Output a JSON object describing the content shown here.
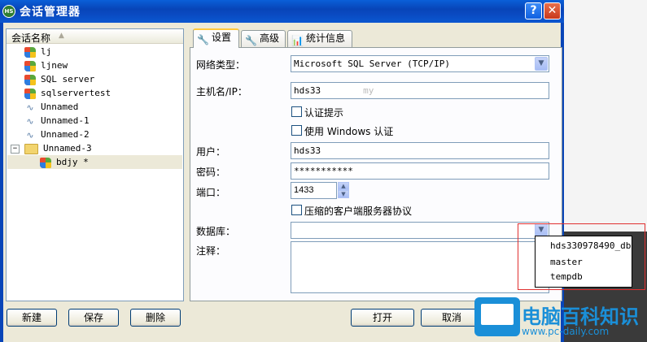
{
  "window": {
    "title": "会话管理器",
    "app_icon": "HS",
    "help_glyph": "?",
    "close_glyph": "✕"
  },
  "tree": {
    "header": "会话名称",
    "items": [
      {
        "label": "lj",
        "icon": "windows-icon"
      },
      {
        "label": "ljnew",
        "icon": "windows-icon"
      },
      {
        "label": "SQL server",
        "icon": "windows-icon"
      },
      {
        "label": "sqlservertest",
        "icon": "windows-icon"
      },
      {
        "label": "Unnamed",
        "icon": "mysql-dolphin-icon"
      },
      {
        "label": "Unnamed-1",
        "icon": "mysql-dolphin-icon"
      },
      {
        "label": "Unnamed-2",
        "icon": "mysql-dolphin-icon"
      },
      {
        "label": "Unnamed-3",
        "icon": "folder-icon",
        "expander": "−"
      },
      {
        "label": "bdjy *",
        "icon": "windows-edit-icon"
      }
    ]
  },
  "buttons": {
    "new": "新建",
    "save": "保存",
    "delete": "删除",
    "open": "打开",
    "cancel": "取消"
  },
  "tabs": [
    {
      "label": "设置",
      "icon": "wrench-icon"
    },
    {
      "label": "高级",
      "icon": "wrench-icon"
    },
    {
      "label": "统计信息",
      "icon": "bar-chart-icon"
    }
  ],
  "form": {
    "network_type_label": "网络类型：",
    "network_type_value": "Microsoft SQL Server (TCP/IP)",
    "host_label": "主机名/IP：",
    "host_value": "hds33",
    "host_value_tail": "my",
    "auth_prompt_label": "认证提示",
    "windows_auth_label": "使用 Windows 认证",
    "user_label": "用户：",
    "user_value": "hds33",
    "password_label": "密码：",
    "password_value": "***********",
    "port_label": "端口：",
    "port_value": "1433",
    "compress_label": "压缩的客户端服务器协议",
    "database_label": "数据库：",
    "database_value": "",
    "comment_label": "注释："
  },
  "database_dropdown": {
    "options": [
      "hds330978490_db",
      "master",
      "tempdb"
    ]
  },
  "watermark": {
    "title": "电脑百科知识",
    "url": "www.pc-daily.com"
  }
}
